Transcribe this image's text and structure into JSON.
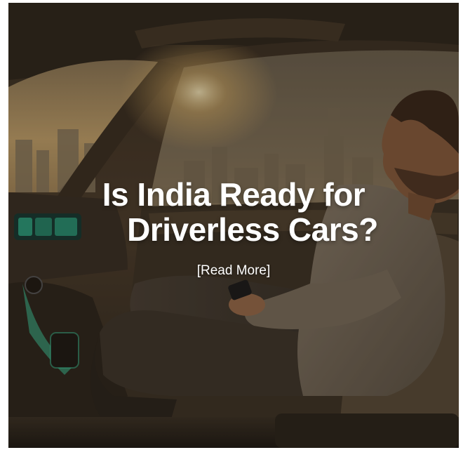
{
  "post": {
    "headline_line1": "Is India Ready for",
    "headline_line2": "Driverless Cars?",
    "cta_label": "[Read More]"
  },
  "colors": {
    "headline_text": "#ffffff",
    "cta_text": "#ffffff",
    "overlay_tint": "#14100a",
    "cabin_tone": "#4a3c2b",
    "skyline_glow": "#e3c07d",
    "dashboard_accent": "#3fd6a6"
  }
}
